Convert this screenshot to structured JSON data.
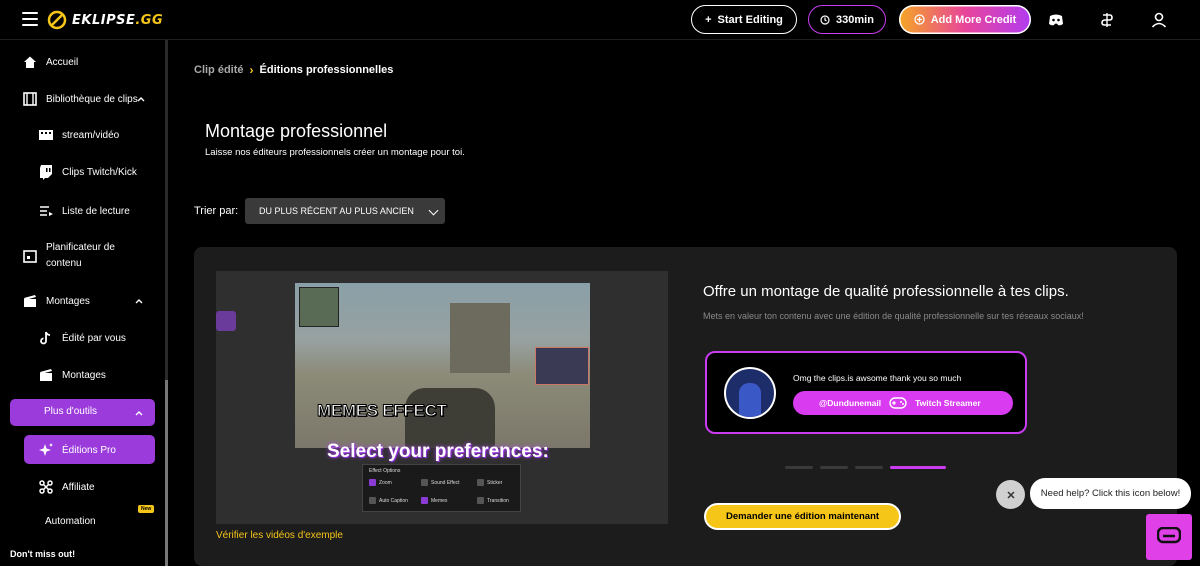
{
  "header": {
    "logo_text": "EKLIPSE",
    "logo_suffix": ".GG",
    "start_editing": "Start Editing",
    "minutes": "330min",
    "add_credit": "Add More Credit"
  },
  "sidebar": {
    "items": [
      {
        "label": "Accueil"
      },
      {
        "label": "Bibliothèque de clips"
      },
      {
        "label": "stream/vidéo"
      },
      {
        "label": "Clips Twitch/Kick"
      },
      {
        "label": "Liste de lecture"
      },
      {
        "label": "Planificateur de contenu"
      },
      {
        "label": "Montages"
      },
      {
        "label": "Édité par vous"
      },
      {
        "label": "Montages"
      },
      {
        "label": "Plus d'outils"
      },
      {
        "label": "Éditions Pro"
      },
      {
        "label": "Affiliate"
      },
      {
        "label": "Automation"
      }
    ],
    "new_badge": "New",
    "dont_miss": "Don't miss out!"
  },
  "breadcrumb": {
    "parent": "Clip édité",
    "current": "Éditions professionnelles"
  },
  "page": {
    "title": "Montage professionnel",
    "subtitle": "Laisse nos éditeurs professionnels créer un montage pour toi.",
    "sort_label": "Trier par:",
    "sort_value": "DU PLUS RÉCENT AU PLUS ANCIEN"
  },
  "video": {
    "memes_text": "MEMES EFFECT",
    "select_text": "Select your preferences:",
    "effect_title": "Effect Options",
    "options": [
      "Zoom",
      "Sound Effect",
      "Sticker",
      "Auto Caption",
      "Memes",
      "Transition"
    ],
    "link": "Vérifier les vidéos d'exemple"
  },
  "offer": {
    "title": "Offre un montage de qualité professionnelle à tes clips.",
    "description": "Mets en valeur ton contenu avec une édition de qualité professionnelle sur tes réseaux sociaux!",
    "quote": "Omg the clips.is awsome thank you so much",
    "handle": "@Dundunemail",
    "role": "Twitch Streamer",
    "cta": "Demander une édition maintenant"
  },
  "help": {
    "bubble": "Need help? Click this icon below!"
  },
  "colors": {
    "accent_purple": "#9b3bdb",
    "accent_yellow": "#f5c518",
    "pink": "#d83bf0"
  }
}
